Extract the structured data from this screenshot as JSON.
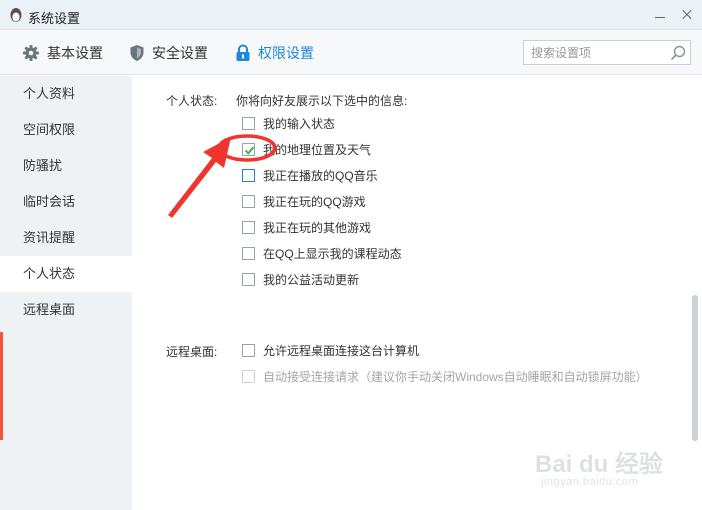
{
  "window": {
    "title": "系统设置"
  },
  "toolbar": {
    "tabs": [
      {
        "label": "基本设置",
        "icon": "gear-icon",
        "active": false
      },
      {
        "label": "安全设置",
        "icon": "shield-icon",
        "active": false
      },
      {
        "label": "权限设置",
        "icon": "lock-icon",
        "active": true
      }
    ],
    "search": {
      "placeholder": "搜索设置项",
      "value": ""
    }
  },
  "sidebar": {
    "items": [
      {
        "label": "个人资料",
        "active": false
      },
      {
        "label": "空间权限",
        "active": false
      },
      {
        "label": "防骚扰",
        "active": false
      },
      {
        "label": "临时会话",
        "active": false
      },
      {
        "label": "资讯提醒",
        "active": false
      },
      {
        "label": "个人状态",
        "active": true
      },
      {
        "label": "远程桌面",
        "active": false
      }
    ]
  },
  "personal_status": {
    "label": "个人状态:",
    "description": "你将向好友展示以下选中的信息:",
    "options": [
      {
        "label": "我的输入状态",
        "checked": false
      },
      {
        "label": "我的地理位置及天气",
        "checked": true
      },
      {
        "label": "我正在播放的QQ音乐",
        "checked": false
      },
      {
        "label": "我正在玩的QQ游戏",
        "checked": false
      },
      {
        "label": "我正在玩的其他游戏",
        "checked": false
      },
      {
        "label": "在QQ上显示我的课程动态",
        "checked": false
      },
      {
        "label": "我的公益活动更新",
        "checked": false
      }
    ]
  },
  "remote_desktop": {
    "label": "远程桌面:",
    "options": [
      {
        "label": "允许远程桌面连接这台计算机",
        "checked": false,
        "enabled": true
      },
      {
        "label": "自动接受连接请求（建议你手动关闭Windows自动睡眠和自动锁屏功能）",
        "checked": false,
        "enabled": false
      }
    ]
  },
  "watermark": {
    "brand": "Bai du 经验",
    "url": "jingyan.baidu.com"
  },
  "colors": {
    "accent_blue": "#1f88d8",
    "annotation_red": "#f0352f",
    "check_green": "#3bb54a",
    "sidebar_bg": "#eef2f5"
  }
}
